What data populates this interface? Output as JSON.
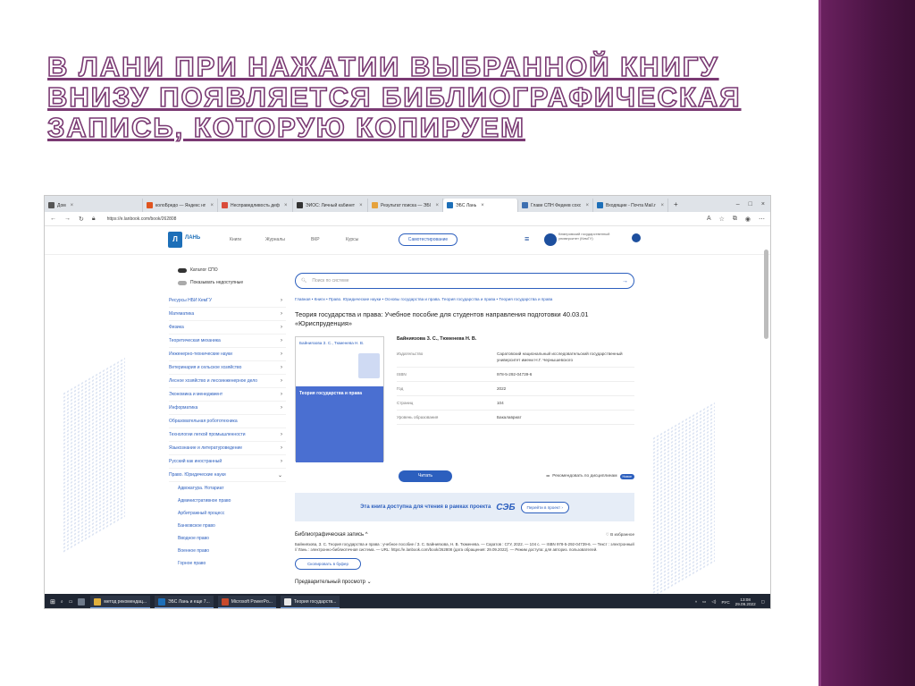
{
  "slide": {
    "title": "В Лани при нажатии выбранной книгу внизу появляется библиографическая запись, которую копируем"
  },
  "browser": {
    "tabs": [
      {
        "label": "Дом",
        "color": "#555555"
      },
      {
        "label": "колоБредо — Яндекс нп",
        "color": "#e0541f"
      },
      {
        "label": "Несправедливость деф",
        "color": "#d94b3a"
      },
      {
        "label": "ЭИОС: Личный кабинет",
        "color": "#333333"
      },
      {
        "label": "Результат поиска — ЭБС",
        "color": "#e6a23c"
      },
      {
        "label": "ЭБС Лань",
        "color": "#1d6fb8",
        "active": true
      },
      {
        "label": "Главе СПН Федеев сохо",
        "color": "#3e6fb0"
      },
      {
        "label": "Входящие - Почта Mail.ru",
        "color": "#1d6fb8"
      }
    ],
    "url": "https://e.lanbook.com/book/262808"
  },
  "site": {
    "logo_text": "ЛАНЬ",
    "nav": [
      "Книги",
      "Журналы",
      "ВКР",
      "Курсы"
    ],
    "self_test_label": "Самотестирование",
    "university": "Кемеровский государственный университет (КемГУ)"
  },
  "sidebar": {
    "toggles": [
      {
        "label": "Каталог СПО",
        "on": true
      },
      {
        "label": "Показывать недоступные",
        "on": false
      }
    ],
    "categories": [
      {
        "label": "Ресурсы НБИ КемГУ",
        "chevron": "›"
      },
      {
        "label": "Математика",
        "chevron": "›"
      },
      {
        "label": "Физика",
        "chevron": "›"
      },
      {
        "label": "Теоретическая механика",
        "chevron": "›"
      },
      {
        "label": "Инженерно-технические науки",
        "chevron": "›"
      },
      {
        "label": "Ветеринария и сельское хозяйство",
        "chevron": "›"
      },
      {
        "label": "Лесное хозяйство и лесоинженерное дело",
        "chevron": "›"
      },
      {
        "label": "Экономика и менеджмент",
        "chevron": "›"
      },
      {
        "label": "Информатика",
        "chevron": "›"
      },
      {
        "label": "Образовательная робототехника",
        "chevron": ""
      },
      {
        "label": "Технологии легкой промышленности",
        "chevron": "›"
      },
      {
        "label": "Языкознание и литературоведение",
        "chevron": "›"
      },
      {
        "label": "Русский как иностранный",
        "chevron": "›"
      },
      {
        "label": "Право. Юридические науки",
        "chevron": "⌄"
      }
    ],
    "subcategories": [
      "Адвокатура. Нотариат",
      "Административное право",
      "Арбитражный процесс",
      "Банковское право",
      "Вводное право",
      "Военное право",
      "Горное право"
    ]
  },
  "book": {
    "search_placeholder": "Поиск по системе",
    "breadcrumb": "Главная • Книги • Право. Юридические науки • Основы государства и права. Теория государства и права • Теория государства и права",
    "title": "Теория государства и права: Учебное пособие для студентов направления подготовки 40.03.01 «Юриспруденция»",
    "cover_authors": "Байниязова З. С., Тюменева Н. В.",
    "cover_title": "Теория государства и права",
    "authors": "Байниязова З. С., Тюменева Н. В.",
    "details": [
      {
        "key": "Издательство",
        "value": "Саратовский национальный исследовательский государственный университет имени Н.Г. Чернышевского"
      },
      {
        "key": "ISBN",
        "value": "978-5-292-04739-6"
      },
      {
        "key": "Год",
        "value": "2022"
      },
      {
        "key": "Страниц",
        "value": "104"
      },
      {
        "key": "Уровень образования",
        "value": "Бакалавриат"
      }
    ],
    "read_label": "Читать",
    "recommend_label": "Рекомендовать по дисциплинам",
    "new_badge": "Новое"
  },
  "ebs": {
    "text": "Эта книга доступна для чтения в рамках проекта",
    "logo": "СЭБ",
    "button": "Перейти в проект ›"
  },
  "bibliography": {
    "heading": "Библиографическая запись ^",
    "favorite_label": "В избранное",
    "text": "Байниязова, З. С. Теория государства и права : учебное пособие / З. С. Байниязова, Н. В. Тюменева. — Саратов : СГУ, 2022. — 104 с. — ISBN 978-5-292-04739-6. — Текст : электронный // Лань : электронно-библиотечная система. — URL: https://e.lanbook.com/book/262808 (дата обращения: 29.09.2022). — Режим доступа: для авториз. пользователей.",
    "copy_label": "Скопировать в буфер",
    "preview_label": "Предварительный просмотр ⌄"
  },
  "taskbar": {
    "apps": [
      "метод рекомендац...",
      "ЭБС Лань и еще 7...",
      "Microsoft PowerPo...",
      "Теория государств..."
    ],
    "lang": "РУС",
    "time": "13:08",
    "date": "29.09.2022"
  }
}
